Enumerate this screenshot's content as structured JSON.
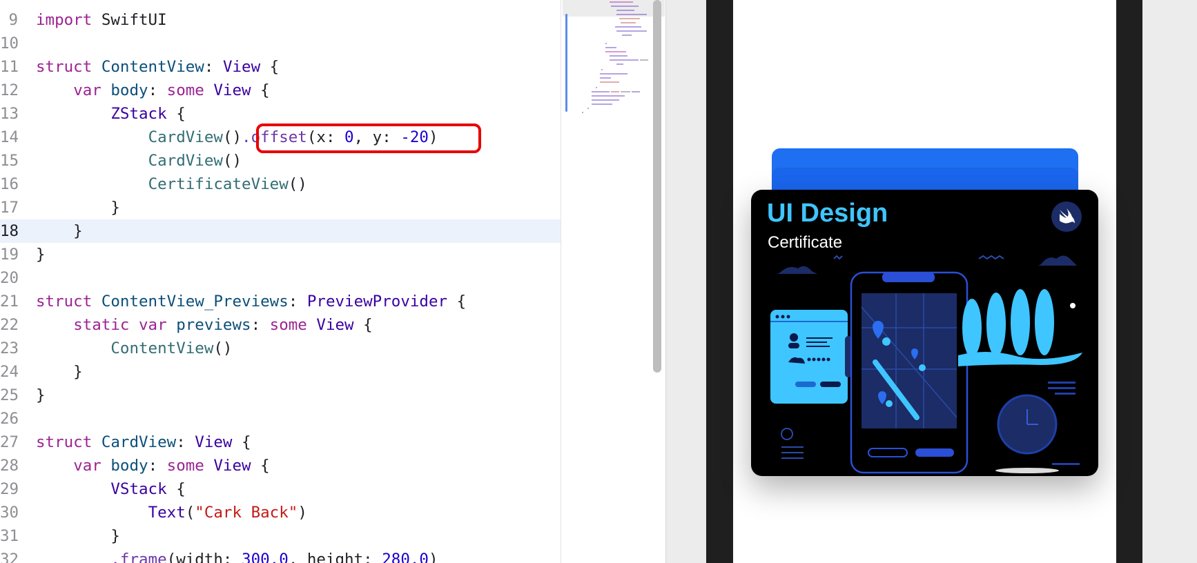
{
  "editor": {
    "current_line": "18",
    "lines": [
      {
        "n": "9",
        "tokens": [
          [
            "import",
            "kw"
          ],
          [
            " SwiftUI",
            "pl"
          ]
        ]
      },
      {
        "n": "10",
        "tokens": []
      },
      {
        "n": "11",
        "tokens": [
          [
            "struct",
            "kw"
          ],
          [
            " ",
            "pl"
          ],
          [
            "ContentView",
            "pt"
          ],
          [
            ": ",
            "pl"
          ],
          [
            "View",
            "ty"
          ],
          [
            " {",
            "pl"
          ]
        ]
      },
      {
        "n": "12",
        "tokens": [
          [
            "    ",
            "pl"
          ],
          [
            "var",
            "kw"
          ],
          [
            " ",
            "pl"
          ],
          [
            "body",
            "pt"
          ],
          [
            ": ",
            "pl"
          ],
          [
            "some",
            "kw"
          ],
          [
            " ",
            "pl"
          ],
          [
            "View",
            "ty"
          ],
          [
            " {",
            "pl"
          ]
        ]
      },
      {
        "n": "13",
        "tokens": [
          [
            "        ",
            "pl"
          ],
          [
            "ZStack",
            "ty"
          ],
          [
            " {",
            "pl"
          ]
        ]
      },
      {
        "n": "14",
        "tokens": [
          [
            "            ",
            "pl"
          ],
          [
            "CardView",
            "pf"
          ],
          [
            "()",
            "pl"
          ],
          [
            ".offset",
            "mth"
          ],
          [
            "(x: ",
            "pl"
          ],
          [
            "0",
            "num"
          ],
          [
            ", y: ",
            "pl"
          ],
          [
            "-20",
            "num"
          ],
          [
            ")",
            "pl"
          ]
        ]
      },
      {
        "n": "15",
        "tokens": [
          [
            "            ",
            "pl"
          ],
          [
            "CardView",
            "pf"
          ],
          [
            "()",
            "pl"
          ]
        ]
      },
      {
        "n": "16",
        "tokens": [
          [
            "            ",
            "pl"
          ],
          [
            "CertificateView",
            "pf"
          ],
          [
            "()",
            "pl"
          ]
        ]
      },
      {
        "n": "17",
        "tokens": [
          [
            "        }",
            "pl"
          ]
        ]
      },
      {
        "n": "18",
        "tokens": [
          [
            "    }",
            "pl"
          ]
        ]
      },
      {
        "n": "19",
        "tokens": [
          [
            "}",
            "pl"
          ]
        ]
      },
      {
        "n": "20",
        "tokens": []
      },
      {
        "n": "21",
        "tokens": [
          [
            "struct",
            "kw"
          ],
          [
            " ",
            "pl"
          ],
          [
            "ContentView_Previews",
            "pt"
          ],
          [
            ": ",
            "pl"
          ],
          [
            "PreviewProvider",
            "ty"
          ],
          [
            " {",
            "pl"
          ]
        ]
      },
      {
        "n": "22",
        "tokens": [
          [
            "    ",
            "pl"
          ],
          [
            "static",
            "kw"
          ],
          [
            " ",
            "pl"
          ],
          [
            "var",
            "kw"
          ],
          [
            " ",
            "pl"
          ],
          [
            "previews",
            "pt"
          ],
          [
            ": ",
            "pl"
          ],
          [
            "some",
            "kw"
          ],
          [
            " ",
            "pl"
          ],
          [
            "View",
            "ty"
          ],
          [
            " {",
            "pl"
          ]
        ]
      },
      {
        "n": "23",
        "tokens": [
          [
            "        ",
            "pl"
          ],
          [
            "ContentView",
            "pf"
          ],
          [
            "()",
            "pl"
          ]
        ]
      },
      {
        "n": "24",
        "tokens": [
          [
            "    }",
            "pl"
          ]
        ]
      },
      {
        "n": "25",
        "tokens": [
          [
            "}",
            "pl"
          ]
        ]
      },
      {
        "n": "26",
        "tokens": []
      },
      {
        "n": "27",
        "tokens": [
          [
            "struct",
            "kw"
          ],
          [
            " ",
            "pl"
          ],
          [
            "CardView",
            "pt"
          ],
          [
            ": ",
            "pl"
          ],
          [
            "View",
            "ty"
          ],
          [
            " {",
            "pl"
          ]
        ]
      },
      {
        "n": "28",
        "tokens": [
          [
            "    ",
            "pl"
          ],
          [
            "var",
            "kw"
          ],
          [
            " ",
            "pl"
          ],
          [
            "body",
            "pt"
          ],
          [
            ": ",
            "pl"
          ],
          [
            "some",
            "kw"
          ],
          [
            " ",
            "pl"
          ],
          [
            "View",
            "ty"
          ],
          [
            " {",
            "pl"
          ]
        ]
      },
      {
        "n": "29",
        "tokens": [
          [
            "        ",
            "pl"
          ],
          [
            "VStack",
            "ty"
          ],
          [
            " {",
            "pl"
          ]
        ]
      },
      {
        "n": "30",
        "tokens": [
          [
            "            ",
            "pl"
          ],
          [
            "Text",
            "ty"
          ],
          [
            "(",
            "pl"
          ],
          [
            "\"Cark Back\"",
            "str"
          ],
          [
            ")",
            "pl"
          ]
        ]
      },
      {
        "n": "31",
        "tokens": [
          [
            "        }",
            "pl"
          ]
        ]
      },
      {
        "n": "32",
        "tokens": [
          [
            "        ",
            "pl"
          ],
          [
            ".frame",
            "mth"
          ],
          [
            "(width: ",
            "pl"
          ],
          [
            "300.0",
            "num"
          ],
          [
            ", height: ",
            "pl"
          ],
          [
            "280.0",
            "num"
          ],
          [
            ")",
            "pl"
          ]
        ]
      }
    ]
  },
  "preview": {
    "certificate": {
      "title": "UI Design",
      "subtitle": "Certificate",
      "badge_icon": "swift-logo-icon"
    }
  },
  "colors": {
    "highlight": "#e80000",
    "card_blue": "#1e6ff2",
    "certificate_bg": "#000000",
    "certificate_title": "#3fc5ff",
    "illustration_light": "#3fc5ff",
    "illustration_dark": "#1b2c66"
  }
}
